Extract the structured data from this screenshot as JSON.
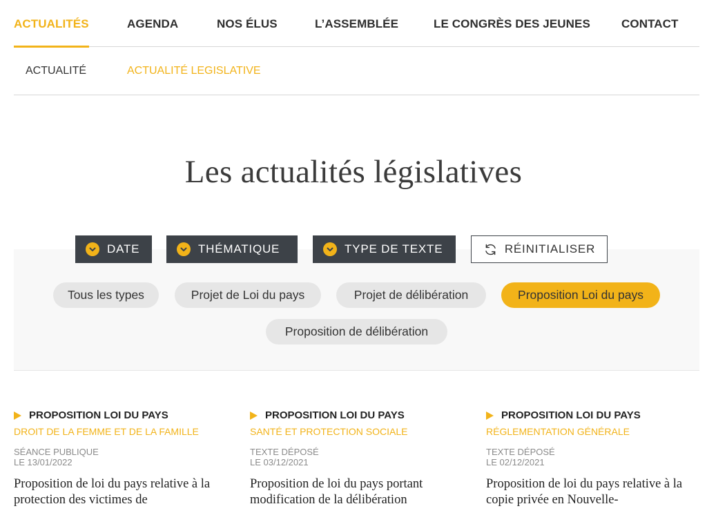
{
  "main_nav": {
    "items": [
      {
        "label": "ACTUALITÉS"
      },
      {
        "label": "AGENDA"
      },
      {
        "label": "NOS ÉLUS"
      },
      {
        "label": "L’ASSEMBLÉE"
      },
      {
        "label": "LE CONGRÈS DES JEUNES"
      },
      {
        "label": "CONTACT"
      }
    ],
    "active": "ACTUALITÉS"
  },
  "sub_nav": {
    "items": [
      {
        "label": "ACTUALITÉ"
      },
      {
        "label": "ACTUALITÉ LEGISLATIVE"
      }
    ],
    "active": "ACTUALITÉ LEGISLATIVE"
  },
  "page": {
    "title": "Les actualités législatives"
  },
  "filters": {
    "buttons": [
      {
        "label": "DATE"
      },
      {
        "label": "THÉMATIQUE"
      },
      {
        "label": "TYPE DE TEXTE"
      }
    ],
    "reset_label": "RÉINITIALISER",
    "types": [
      {
        "label": "Tous les types"
      },
      {
        "label": "Projet de Loi du pays"
      },
      {
        "label": "Projet de délibération"
      },
      {
        "label": "Proposition Loi du pays"
      },
      {
        "label": "Proposition de délibération"
      }
    ],
    "selected_type": "Proposition Loi du pays"
  },
  "articles": [
    {
      "type": "PROPOSITION LOI DU PAYS",
      "theme": "DROIT DE LA FEMME ET DE LA FAMILLE",
      "status": "SÉANCE PUBLIQUE",
      "date": "LE 13/01/2022",
      "description": "Proposition de loi du pays relative à la protection des victimes de"
    },
    {
      "type": "PROPOSITION LOI DU PAYS",
      "theme": "SANTÉ ET PROTECTION SOCIALE",
      "status": "TEXTE DÉPOSÉ",
      "date": "LE 03/12/2021",
      "description": "Proposition de loi du pays portant modification de la délibération"
    },
    {
      "type": "PROPOSITION LOI DU PAYS",
      "theme": "RÉGLEMENTATION GÉNÉRALE",
      "status": "TEXTE DÉPOSÉ",
      "date": "LE 02/12/2021",
      "description": "Proposition de loi du pays relative à la copie privée en Nouvelle-"
    }
  ],
  "colors": {
    "accent": "#f2b319",
    "dark": "#3d4248",
    "chip": "#e6e6e6",
    "panel": "#f8f8f8"
  },
  "icons": {
    "filter_chevron": "chevron-down-icon",
    "reset": "refresh-icon",
    "article_bullet": "triangle-right-icon"
  }
}
